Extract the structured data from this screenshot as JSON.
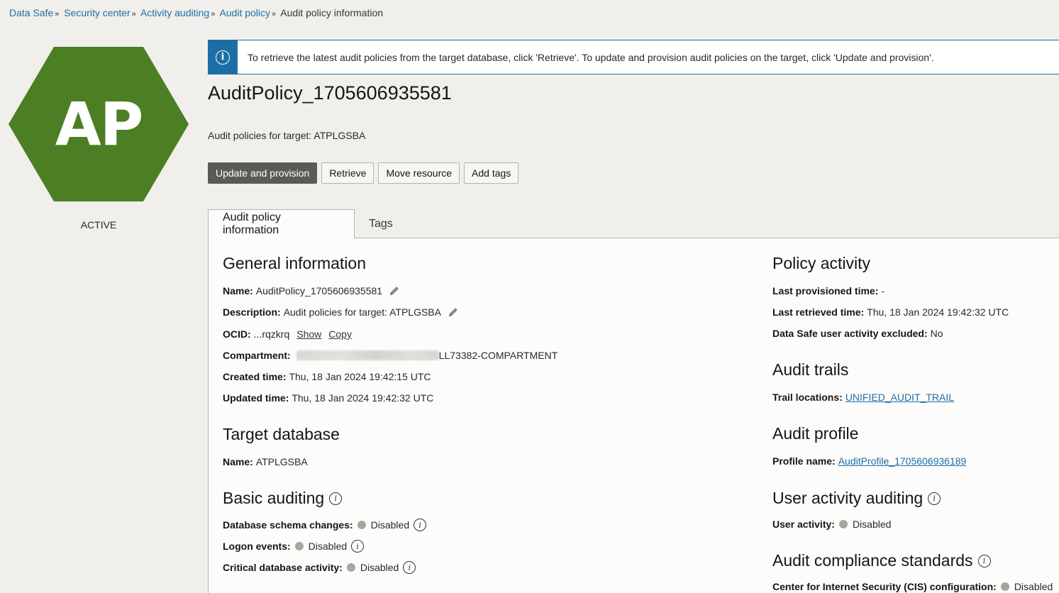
{
  "breadcrumb": {
    "items": [
      "Data Safe",
      "Security center",
      "Activity auditing",
      "Audit policy"
    ],
    "current": "Audit policy information",
    "sep": "»"
  },
  "resource": {
    "initials": "AP",
    "state": "ACTIVE",
    "hex_color": "#4c7f24"
  },
  "banner": {
    "text": "To retrieve the latest audit policies from the target database, click 'Retrieve'. To update and provision audit policies on the target, click 'Update and provision'."
  },
  "header": {
    "title": "AuditPolicy_1705606935581",
    "subtitle": "Audit policies for target: ATPLGSBA"
  },
  "actions": {
    "update_provision": "Update and provision",
    "retrieve": "Retrieve",
    "move_resource": "Move resource",
    "add_tags": "Add tags"
  },
  "tabs": {
    "audit_policy_info": "Audit policy information",
    "tags": "Tags"
  },
  "general": {
    "heading": "General information",
    "name_label": "Name:",
    "name_value": "AuditPolicy_1705606935581",
    "description_label": "Description:",
    "description_value": "Audit policies for target: ATPLGSBA",
    "ocid_label": "OCID:",
    "ocid_value": "...rqzkrq",
    "ocid_show": "Show",
    "ocid_copy": "Copy",
    "compartment_label": "Compartment:",
    "compartment_value": "LL73382-COMPARTMENT",
    "created_label": "Created time:",
    "created_value": "Thu, 18 Jan 2024 19:42:15 UTC",
    "updated_label": "Updated time:",
    "updated_value": "Thu, 18 Jan 2024 19:42:32 UTC"
  },
  "target_db": {
    "heading": "Target database",
    "name_label": "Name:",
    "name_value": "ATPLGSBA"
  },
  "basic_auditing": {
    "heading": "Basic auditing",
    "schema_label": "Database schema changes:",
    "schema_value": "Disabled",
    "logon_label": "Logon events:",
    "logon_value": "Disabled",
    "critical_label": "Critical database activity:",
    "critical_value": "Disabled"
  },
  "policy_activity": {
    "heading": "Policy activity",
    "provisioned_label": "Last provisioned time:",
    "provisioned_value": "-",
    "retrieved_label": "Last retrieved time:",
    "retrieved_value": "Thu, 18 Jan 2024 19:42:32 UTC",
    "excluded_label": "Data Safe user activity excluded:",
    "excluded_value": "No"
  },
  "audit_trails": {
    "heading": "Audit trails",
    "trail_label": "Trail locations:",
    "trail_value": "UNIFIED_AUDIT_TRAIL"
  },
  "audit_profile": {
    "heading": "Audit profile",
    "profile_label": "Profile name:",
    "profile_value": "AuditProfile_1705606936189"
  },
  "user_activity": {
    "heading": "User activity auditing",
    "activity_label": "User activity:",
    "activity_value": "Disabled"
  },
  "compliance": {
    "heading": "Audit compliance standards",
    "cis_label": "Center for Internet Security (CIS) configuration:",
    "cis_value": "Disabled"
  }
}
